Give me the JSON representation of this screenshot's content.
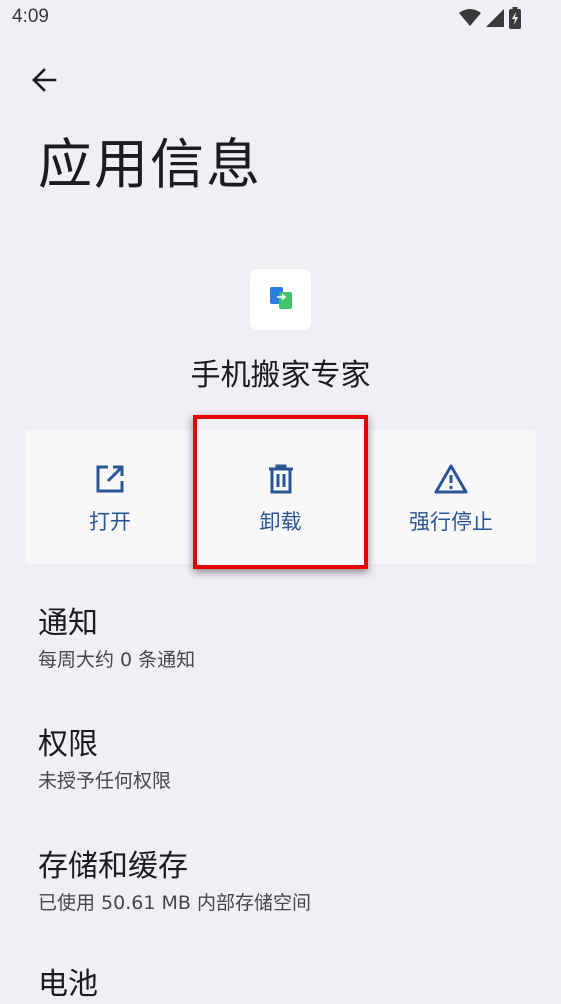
{
  "status_bar": {
    "time": "4:09",
    "icons": [
      "wifi-icon",
      "cell-signal-icon",
      "battery-charging-icon"
    ]
  },
  "header": {
    "back_icon": "arrow-left-icon",
    "title": "应用信息"
  },
  "app": {
    "name": "手机搬家专家",
    "icon": "phone-clone-app-icon"
  },
  "actions": [
    {
      "label": "打开",
      "icon": "open-external-icon"
    },
    {
      "label": "卸载",
      "icon": "trash-icon"
    },
    {
      "label": "强行停止",
      "icon": "warning-triangle-icon"
    }
  ],
  "settings": [
    {
      "title": "通知",
      "subtitle": "每周大约 0 条通知"
    },
    {
      "title": "权限",
      "subtitle": "未授予任何权限"
    },
    {
      "title": "存储和缓存",
      "subtitle": "已使用 50.61 MB 内部存储空间"
    },
    {
      "title": "电池",
      "subtitle": ""
    }
  ],
  "colors": {
    "background": "#f0eff4",
    "accent": "#2a5695",
    "highlight": "#e60000"
  }
}
